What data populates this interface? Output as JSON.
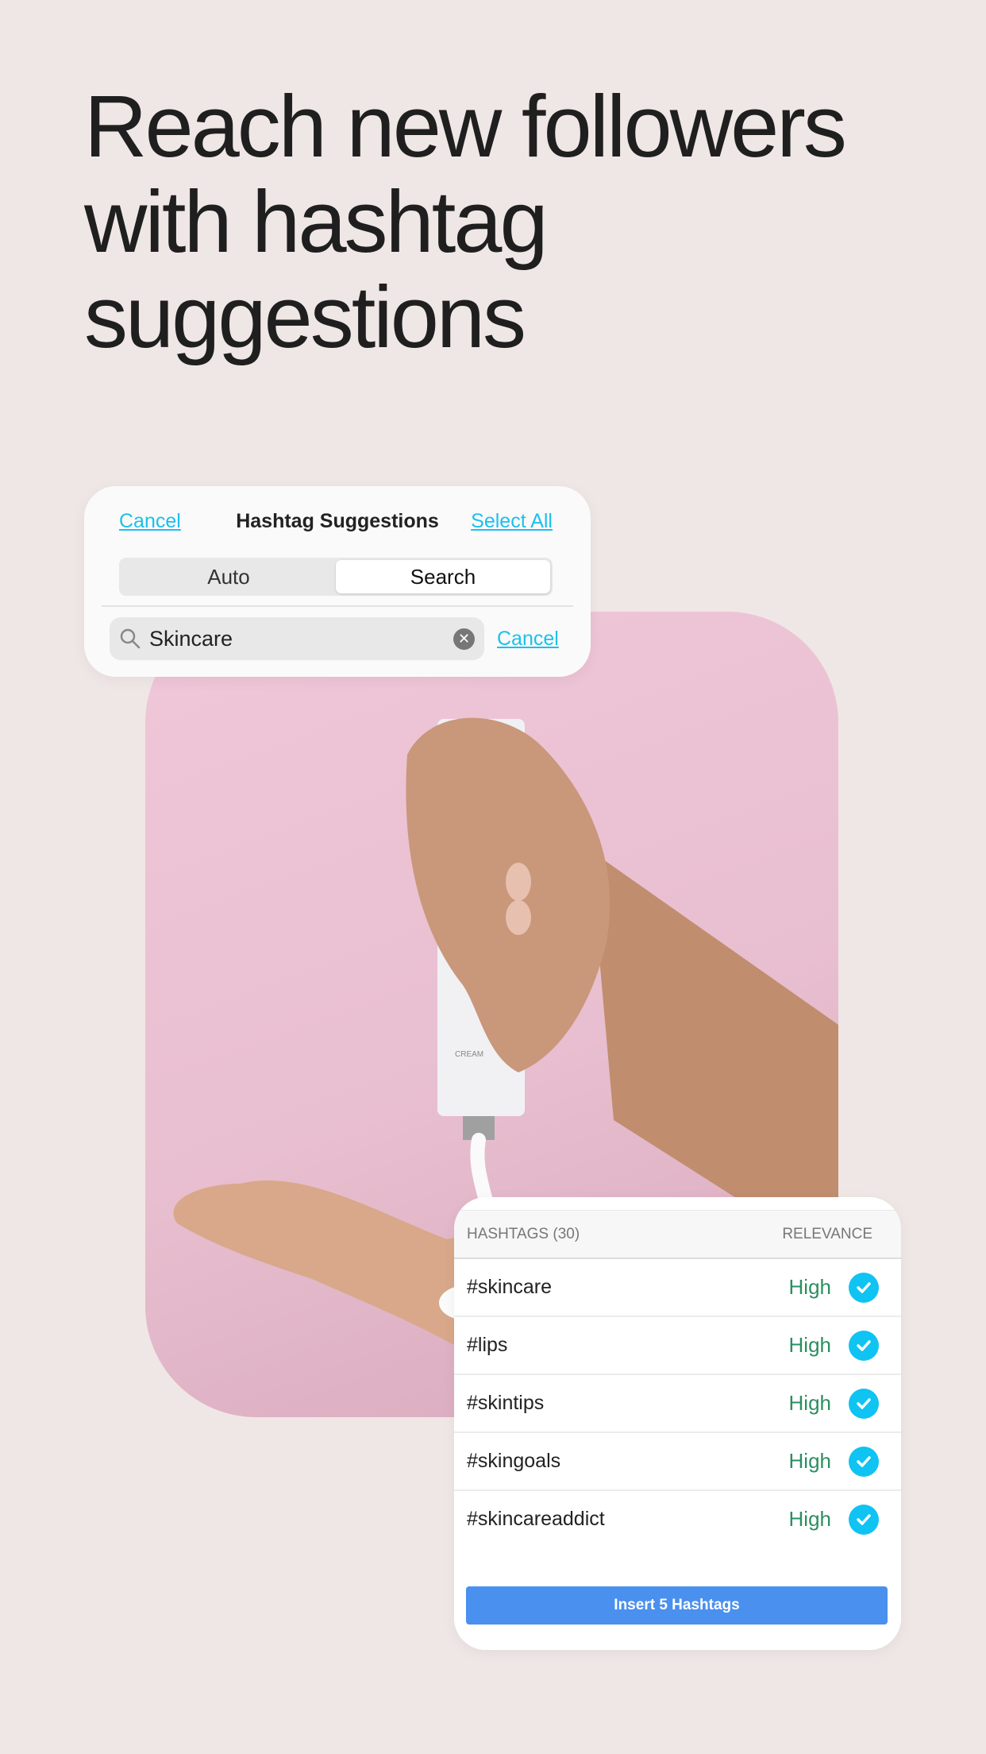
{
  "headline": "Reach new followers with hashtag suggestions",
  "photo": {
    "description_label": "CREAM",
    "background": "#ebc4d4"
  },
  "dialog": {
    "cancel_label": "Cancel",
    "title": "Hashtag Suggestions",
    "select_all_label": "Select All",
    "segments": [
      {
        "label": "Auto",
        "selected": false
      },
      {
        "label": "Search",
        "selected": true
      }
    ],
    "search": {
      "value": "Skincare",
      "cancel_label": "Cancel",
      "icon": "search-icon"
    }
  },
  "results": {
    "header_hashtags": "HASHTAGS (30)",
    "header_relevance": "RELEVANCE",
    "rows": [
      {
        "tag": "#skincare",
        "relevance": "High",
        "checked": true
      },
      {
        "tag": "#lips",
        "relevance": "High",
        "checked": true
      },
      {
        "tag": "#skintips",
        "relevance": "High",
        "checked": true
      },
      {
        "tag": "#skingoals",
        "relevance": "High",
        "checked": true
      },
      {
        "tag": "#skincareaddict",
        "relevance": "High",
        "checked": true
      }
    ],
    "insert_label": "Insert 5 Hashtags"
  },
  "colors": {
    "accent": "#1cc0ec",
    "check": "#0fc3f2",
    "relevance_high": "#2a8f60",
    "button": "#4a90ee",
    "background": "#efe7e5"
  }
}
